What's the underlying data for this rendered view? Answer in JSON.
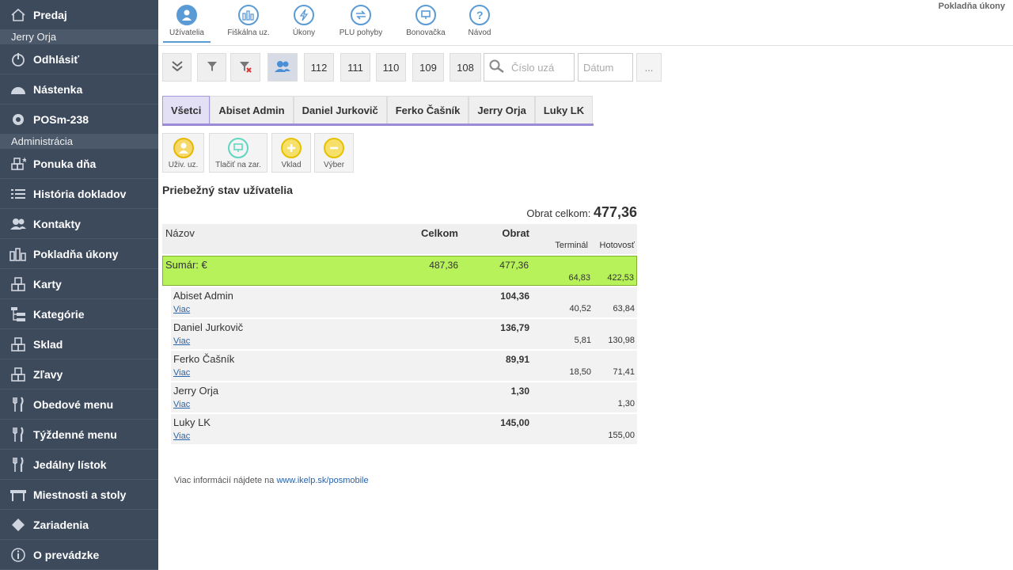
{
  "sidebar": {
    "predaj": "Predaj",
    "user_name": "Jerry Orja",
    "logout": "Odhlásiť",
    "dashboard": "Nástenka",
    "pos": "POSm-238",
    "admin_header": "Administrácia",
    "items": [
      {
        "label": "Ponuka dňa",
        "icon": "boxes-star-icon"
      },
      {
        "label": "História dokladov",
        "icon": "list-icon"
      },
      {
        "label": "Kontakty",
        "icon": "users-icon"
      },
      {
        "label": "Pokladňa úkony",
        "icon": "bar-chart-icon"
      },
      {
        "label": "Karty",
        "icon": "boxes-icon"
      },
      {
        "label": "Kategórie",
        "icon": "tree-icon"
      },
      {
        "label": "Sklad",
        "icon": "boxes-icon"
      },
      {
        "label": "Zľavy",
        "icon": "boxes-icon"
      },
      {
        "label": "Obedové menu",
        "icon": "cutlery-icon"
      },
      {
        "label": "Týždenné menu",
        "icon": "cutlery-icon"
      },
      {
        "label": "Jedálny lístok",
        "icon": "cutlery-icon"
      },
      {
        "label": "Miestnosti a stoly",
        "icon": "table-icon"
      },
      {
        "label": "Zariadenia",
        "icon": "diamond-icon"
      },
      {
        "label": "O prevádzke",
        "icon": "info-icon"
      }
    ]
  },
  "topbar": {
    "page_title": "Pokladňa úkony",
    "buttons": [
      {
        "label": "Užívatelia",
        "icon": "user-icon"
      },
      {
        "label": "Fiškálna uz.",
        "icon": "bar-chart-icon"
      },
      {
        "label": "Úkony",
        "icon": "bolt-icon"
      },
      {
        "label": "PLU pohyby",
        "icon": "arrows-icon"
      },
      {
        "label": "Bonovačka",
        "icon": "monitor-icon"
      },
      {
        "label": "Návod",
        "icon": "question-icon"
      }
    ]
  },
  "toolbar": {
    "numbers": [
      "112",
      "111",
      "110",
      "109",
      "108"
    ],
    "search_placeholder": "Číslo uzá",
    "date_placeholder": "Dátum",
    "more": "..."
  },
  "tabs": [
    "Všetci",
    "Abiset Admin",
    "Daniel Jurkovič",
    "Ferko Čašník",
    "Jerry Orja",
    "Luky LK"
  ],
  "actions": [
    {
      "label": "Uživ. uz.",
      "icon": "user-icon",
      "color": "#e6b800"
    },
    {
      "label": "Tlačiť na zar.",
      "icon": "monitor-icon",
      "color": "#5fd6c1"
    },
    {
      "label": "Vklad",
      "icon": "plus-icon",
      "color": "#e6c100"
    },
    {
      "label": "Výber",
      "icon": "minus-icon",
      "color": "#e6c100"
    }
  ],
  "section_title": "Priebežný stav užívatelia",
  "obrat_label": "Obrat celkom:",
  "obrat_value": "477,36",
  "table": {
    "headers": {
      "name": "Názov",
      "celkom": "Celkom",
      "obrat": "Obrat",
      "terminal": "Terminál",
      "hotovost": "Hotovosť"
    },
    "sum": {
      "name": "Sumár: €",
      "celkom": "487,36",
      "obrat": "477,36",
      "terminal": "64,83",
      "hotovost": "422,53"
    },
    "rows": [
      {
        "name": "Abiset Admin",
        "obrat": "104,36",
        "terminal": "40,52",
        "hotovost": "63,84",
        "link": "Viac"
      },
      {
        "name": "Daniel Jurkovič",
        "obrat": "136,79",
        "terminal": "5,81",
        "hotovost": "130,98",
        "link": "Viac"
      },
      {
        "name": "Ferko Čašník",
        "obrat": "89,91",
        "terminal": "18,50",
        "hotovost": "71,41",
        "link": "Viac"
      },
      {
        "name": "Jerry Orja",
        "obrat": "1,30",
        "terminal": "",
        "hotovost": "1,30",
        "link": "Viac"
      },
      {
        "name": "Luky LK",
        "obrat": "145,00",
        "terminal": "",
        "hotovost": "155,00",
        "link": "Viac"
      }
    ]
  },
  "footer": {
    "text": "Viac informácií nájdete na",
    "link": "www.ikelp.sk/posmobile"
  },
  "colors": {
    "sidebar": "#3d4a5c",
    "accent": "#5b9bd5",
    "sum_row": "#b8f25a",
    "tab_active": "#e3e0f5"
  }
}
